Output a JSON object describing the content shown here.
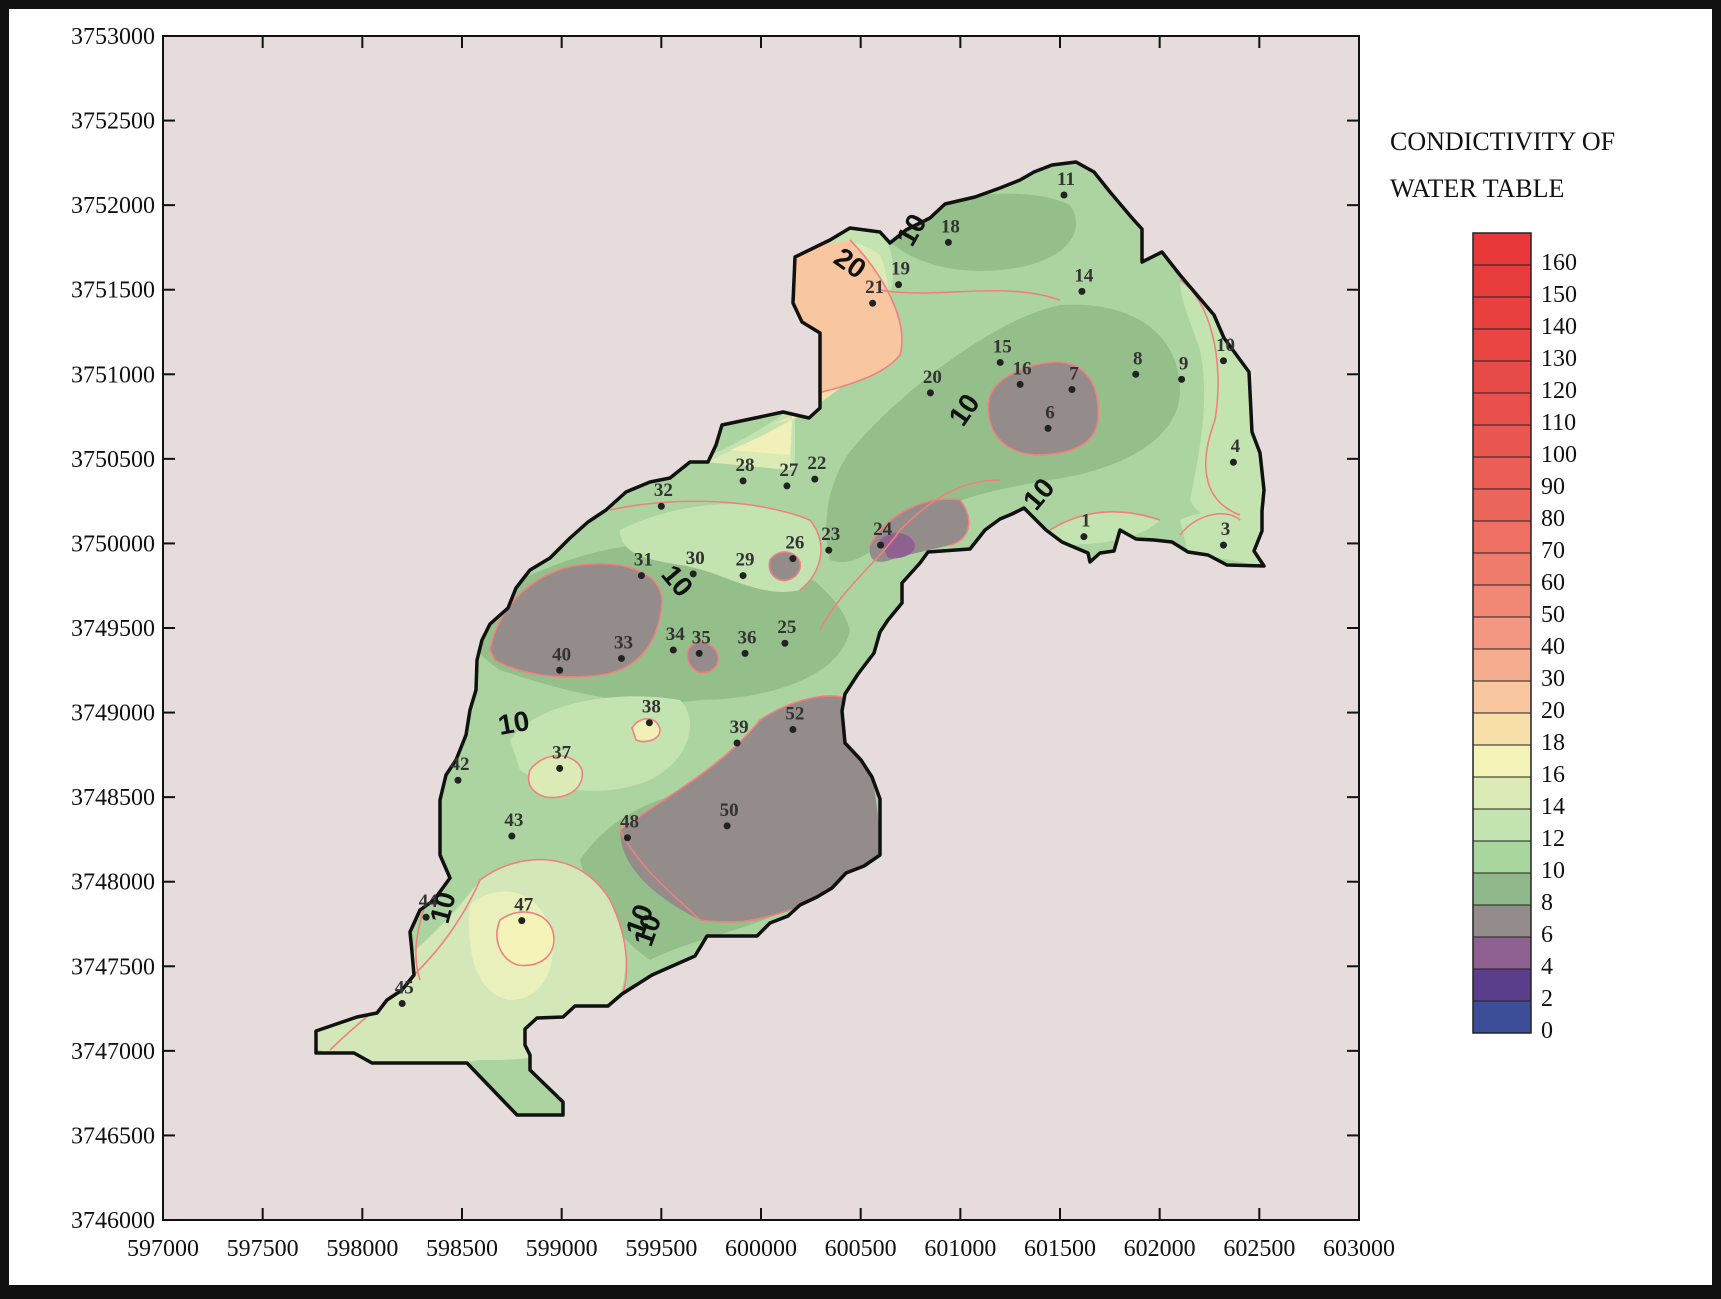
{
  "legend": {
    "title_line1": "CONDICTIVITY OF",
    "title_line2": "WATER TABLE",
    "classes": [
      {
        "value": "160",
        "color": "#e8383a"
      },
      {
        "value": "150",
        "color": "#e83c3c"
      },
      {
        "value": "140",
        "color": "#e8403f"
      },
      {
        "value": "130",
        "color": "#e84543"
      },
      {
        "value": "120",
        "color": "#e84a47"
      },
      {
        "value": "110",
        "color": "#e9504b"
      },
      {
        "value": "100",
        "color": "#ea5750"
      },
      {
        "value": "90",
        "color": "#eb5e56"
      },
      {
        "value": "80",
        "color": "#ec665c"
      },
      {
        "value": "70",
        "color": "#ee7063"
      },
      {
        "value": "60",
        "color": "#ef7b6b"
      },
      {
        "value": "50",
        "color": "#f18876"
      },
      {
        "value": "40",
        "color": "#f39782"
      },
      {
        "value": "30",
        "color": "#f6ad8f"
      },
      {
        "value": "20",
        "color": "#f8c79f"
      },
      {
        "value": "18",
        "color": "#f7e0aa"
      },
      {
        "value": "16",
        "color": "#f4f3b8"
      },
      {
        "value": "14",
        "color": "#dcebb6"
      },
      {
        "value": "12",
        "color": "#c3e3b0"
      },
      {
        "value": "10",
        "color": "#a9d59f"
      },
      {
        "value": "8",
        "color": "#8fb98a"
      },
      {
        "value": "6",
        "color": "#938c8a"
      },
      {
        "value": "4",
        "color": "#8e6190"
      },
      {
        "value": "2",
        "color": "#5a3e8c"
      },
      {
        "value": "0",
        "color": "#3c4e98"
      }
    ]
  },
  "axes": {
    "x_ticks": [
      "597000",
      "597500",
      "598000",
      "598500",
      "599000",
      "599500",
      "600000",
      "600500",
      "601000",
      "601500",
      "602000",
      "602500",
      "603000"
    ],
    "y_ticks": [
      "3753000",
      "3752500",
      "3752000",
      "3751500",
      "3751000",
      "3750500",
      "3750000",
      "3749500",
      "3749000",
      "3748500",
      "3748000",
      "3747500",
      "3747000",
      "3746500",
      "3746000"
    ],
    "x_range": [
      597000,
      603000
    ],
    "y_range": [
      3746000,
      3753000
    ]
  },
  "contour_labels": [
    "10",
    "20",
    "10",
    "10",
    "10",
    "10",
    "10",
    "10",
    "10"
  ],
  "wells": [
    {
      "id": "1",
      "x": 601620,
      "y": 3750040
    },
    {
      "id": "3",
      "x": 602320,
      "y": 3749990
    },
    {
      "id": "4",
      "x": 602370,
      "y": 3750480
    },
    {
      "id": "6",
      "x": 601440,
      "y": 3750680
    },
    {
      "id": "7",
      "x": 601560,
      "y": 3750910
    },
    {
      "id": "8",
      "x": 601880,
      "y": 3751000
    },
    {
      "id": "9",
      "x": 602110,
      "y": 3750970
    },
    {
      "id": "10",
      "x": 602320,
      "y": 3751080
    },
    {
      "id": "11",
      "x": 601520,
      "y": 3752060
    },
    {
      "id": "14",
      "x": 601610,
      "y": 3751490
    },
    {
      "id": "15",
      "x": 601200,
      "y": 3751070
    },
    {
      "id": "16",
      "x": 601300,
      "y": 3750940
    },
    {
      "id": "18",
      "x": 600940,
      "y": 3751780
    },
    {
      "id": "19",
      "x": 600690,
      "y": 3751530
    },
    {
      "id": "20",
      "x": 600850,
      "y": 3750890
    },
    {
      "id": "21",
      "x": 600560,
      "y": 3751420
    },
    {
      "id": "22",
      "x": 600270,
      "y": 3750380
    },
    {
      "id": "23",
      "x": 600340,
      "y": 3749960
    },
    {
      "id": "24",
      "x": 600600,
      "y": 3749990
    },
    {
      "id": "25",
      "x": 600120,
      "y": 3749410
    },
    {
      "id": "26",
      "x": 600160,
      "y": 3749910
    },
    {
      "id": "27",
      "x": 600130,
      "y": 3750340
    },
    {
      "id": "28",
      "x": 599910,
      "y": 3750370
    },
    {
      "id": "29",
      "x": 599910,
      "y": 3749810
    },
    {
      "id": "30",
      "x": 599660,
      "y": 3749820
    },
    {
      "id": "31",
      "x": 599400,
      "y": 3749810
    },
    {
      "id": "32",
      "x": 599500,
      "y": 3750220
    },
    {
      "id": "33",
      "x": 599300,
      "y": 3749320
    },
    {
      "id": "34",
      "x": 599560,
      "y": 3749370
    },
    {
      "id": "35",
      "x": 599690,
      "y": 3749350
    },
    {
      "id": "36",
      "x": 599920,
      "y": 3749350
    },
    {
      "id": "37",
      "x": 598990,
      "y": 3748670
    },
    {
      "id": "38",
      "x": 599440,
      "y": 3748940
    },
    {
      "id": "39",
      "x": 599880,
      "y": 3748820
    },
    {
      "id": "40",
      "x": 598990,
      "y": 3749250
    },
    {
      "id": "42",
      "x": 598480,
      "y": 3748600
    },
    {
      "id": "43",
      "x": 598750,
      "y": 3748270
    },
    {
      "id": "44",
      "x": 598320,
      "y": 3747790
    },
    {
      "id": "45",
      "x": 598200,
      "y": 3747280
    },
    {
      "id": "47",
      "x": 598800,
      "y": 3747770
    },
    {
      "id": "48",
      "x": 599330,
      "y": 3748260
    },
    {
      "id": "50",
      "x": 599830,
      "y": 3748330
    },
    {
      "id": "52",
      "x": 600160,
      "y": 3748900
    }
  ]
}
